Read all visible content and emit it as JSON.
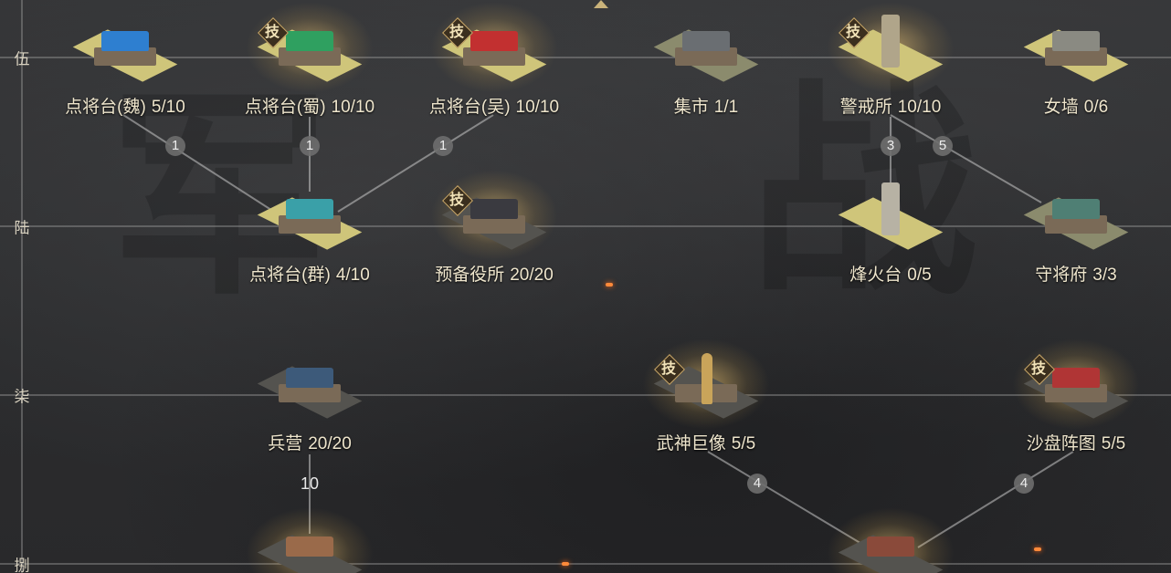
{
  "rows": [
    "伍",
    "陆",
    "柒",
    "捌"
  ],
  "buildings": [
    {
      "name": "点将台(魏)",
      "progress": "5/10",
      "tech": false,
      "roof_color": "#2e7fd0",
      "base": "yellow"
    },
    {
      "name": "点将台(蜀)",
      "progress": "10/10",
      "tech": true,
      "roof_color": "#2fa060",
      "base": "yellow"
    },
    {
      "name": "点将台(吴)",
      "progress": "10/10",
      "tech": true,
      "roof_color": "#c23030",
      "base": "yellow"
    },
    {
      "name": "集市",
      "progress": "1/1",
      "tech": false,
      "roof_color": "#6a6e72",
      "base": "grey"
    },
    {
      "name": "警戒所",
      "progress": "10/10",
      "tech": true,
      "roof_color": "#b0a58a",
      "base": "yellow"
    },
    {
      "name": "女墙",
      "progress": "0/6",
      "tech": false,
      "roof_color": "#8a8a82",
      "base": "yellow"
    },
    {
      "name": "点将台(群)",
      "progress": "4/10",
      "tech": false,
      "roof_color": "#3aa0a8",
      "base": "yellow"
    },
    {
      "name": "预备役所",
      "progress": "20/20",
      "tech": true,
      "roof_color": "#3a3a40",
      "base": "dark"
    },
    {
      "name": "烽火台",
      "progress": "0/5",
      "tech": false,
      "roof_color": "#b7b2a4",
      "base": "yellow"
    },
    {
      "name": "守将府",
      "progress": "3/3",
      "tech": false,
      "roof_color": "#4f7f74",
      "base": "grey"
    },
    {
      "name": "兵营",
      "progress": "20/20",
      "tech": false,
      "roof_color": "#3d5a7a",
      "base": "dark"
    },
    {
      "name": "武神巨像",
      "progress": "5/5",
      "tech": true,
      "roof_color": "#c9a45a",
      "base": "dark"
    },
    {
      "name": "沙盘阵图",
      "progress": "5/5",
      "tech": true,
      "roof_color": "#b03535",
      "base": "dark"
    }
  ],
  "partial_buildings": [
    {
      "roof_color": "#9a6a4a"
    },
    {
      "roof_color": "#8a4a3a"
    }
  ],
  "links": [
    {
      "value": "1"
    },
    {
      "value": "1"
    },
    {
      "value": "1"
    },
    {
      "value": "3"
    },
    {
      "value": "5"
    },
    {
      "value": "10"
    },
    {
      "value": "4"
    },
    {
      "value": "4"
    }
  ],
  "tech_label": "技",
  "brush_chars": [
    "军",
    "战"
  ]
}
